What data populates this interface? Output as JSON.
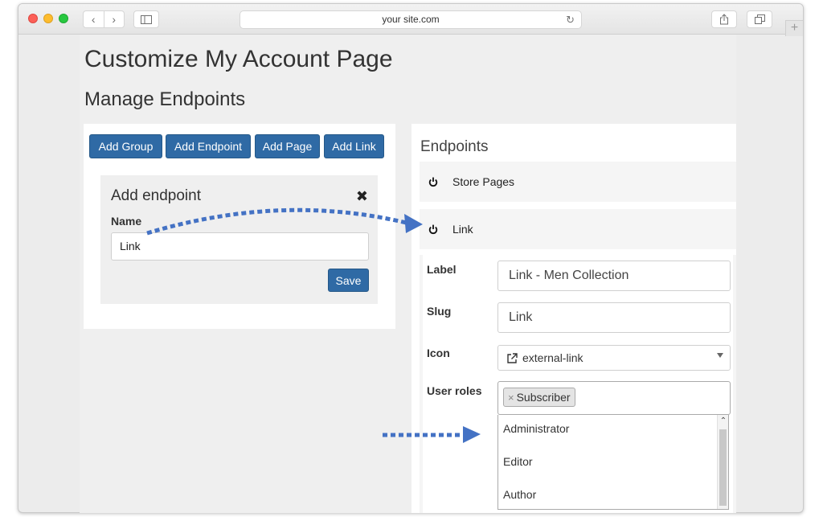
{
  "browser": {
    "url": "your site.com"
  },
  "page": {
    "title": "Customize My Account Page",
    "section_title": "Manage Endpoints"
  },
  "toolbar": {
    "buttons": [
      "Add Group",
      "Add Endpoint",
      "Add Page",
      "Add Link"
    ]
  },
  "add_endpoint": {
    "title": "Add endpoint",
    "close": "✖",
    "name_label": "Name",
    "name_value": "Link",
    "save_label": "Save"
  },
  "endpoints": {
    "heading": "Endpoints",
    "items": [
      {
        "label": "Store Pages",
        "icon": "power-icon"
      },
      {
        "label": "Link",
        "icon": "power-icon"
      }
    ],
    "details": {
      "label_label": "Label",
      "label_value": "Link - Men Collection",
      "slug_label": "Slug",
      "slug_value": "Link",
      "icon_label": "Icon",
      "icon_value": "external-link",
      "roles_label": "User roles",
      "roles_selected": [
        "Subscriber"
      ],
      "roles_options": [
        "Administrator",
        "Editor",
        "Author"
      ]
    }
  },
  "colors": {
    "button_blue": "#2f6aa5",
    "arrow_blue": "#4472c4"
  }
}
